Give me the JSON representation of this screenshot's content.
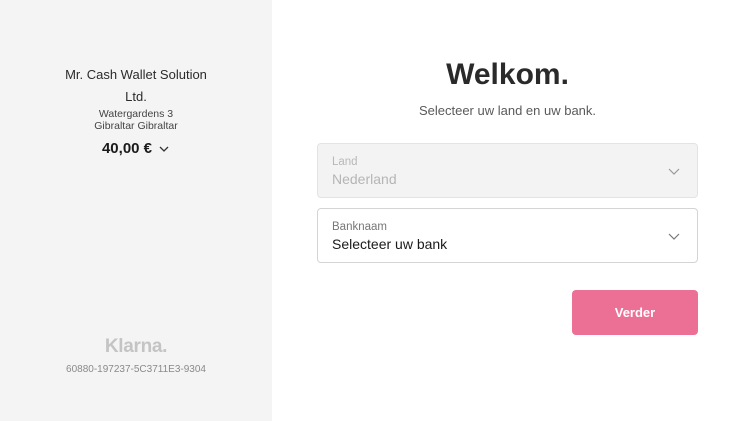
{
  "merchant": {
    "name": "Mr. Cash Wallet Solution Ltd.",
    "address_line1": "Watergardens 3",
    "address_line2": "Gibraltar Gibraltar",
    "amount": "40,00 €"
  },
  "branding": {
    "logo_text": "Klarna.",
    "reference": "60880-197237-5C3711E3-9304"
  },
  "main": {
    "title": "Welkom.",
    "subtitle": "Selecteer uw land en uw bank."
  },
  "country_field": {
    "label": "Land",
    "value": "Nederland"
  },
  "bank_field": {
    "label": "Banknaam",
    "value": "Selecteer uw bank"
  },
  "continue_button": {
    "label": "Verder"
  },
  "colors": {
    "accent": "#ec7096",
    "sidebar_bg": "#f4f4f4"
  },
  "icons": {
    "amount_toggle": "chevron-down-icon",
    "country_dropdown": "chevron-down-icon",
    "bank_dropdown": "chevron-down-icon"
  }
}
